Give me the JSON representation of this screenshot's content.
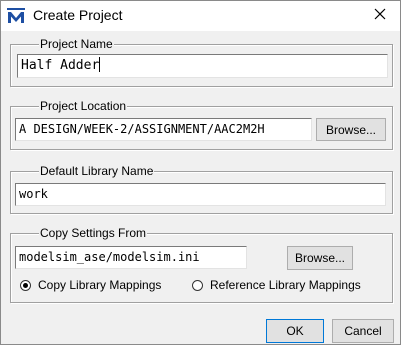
{
  "window": {
    "title": "Create Project",
    "app_icon": "modelsim-m-icon",
    "close_icon": "close-icon"
  },
  "project_name": {
    "legend": "Project Name",
    "value": "Half Adder"
  },
  "project_location": {
    "legend": "Project Location",
    "value": "A DESIGN/WEEK-2/ASSIGNMENT/AAC2M2H",
    "browse_label": "Browse..."
  },
  "default_library": {
    "legend": "Default Library Name",
    "value": "work"
  },
  "copy_settings": {
    "legend": "Copy Settings From",
    "value": "modelsim_ase/modelsim.ini",
    "browse_label": "Browse...",
    "options": [
      {
        "label": "Copy Library Mappings",
        "selected": true
      },
      {
        "label": "Reference Library Mappings",
        "selected": false
      }
    ]
  },
  "footer": {
    "ok_label": "OK",
    "cancel_label": "Cancel"
  },
  "colors": {
    "accent": "#0078d7",
    "icon_blue": "#1e4fa3"
  }
}
